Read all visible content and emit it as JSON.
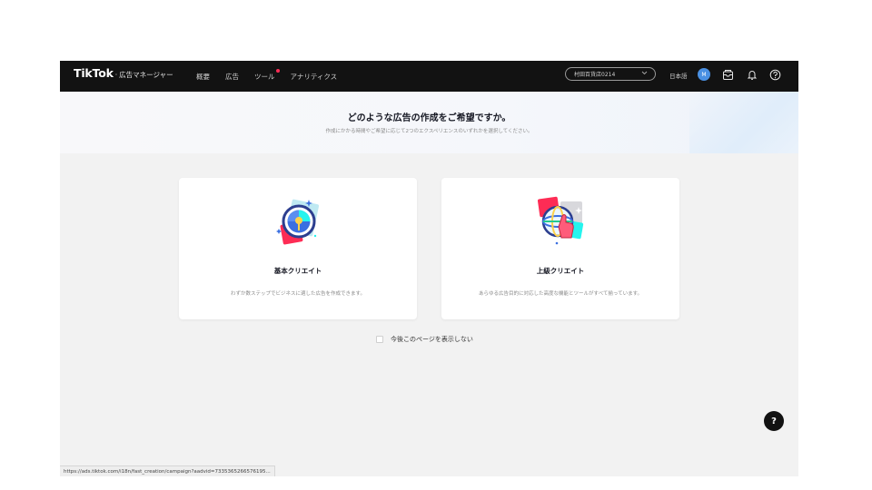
{
  "topbar": {
    "brand": "TikTok",
    "brand_suffix": "·",
    "product": "広告マネージャー",
    "nav": [
      "概要",
      "広告",
      "ツール",
      "アナリティクス"
    ],
    "account": "村田百貨店0214",
    "language": "日本語",
    "avatar_initial": "M"
  },
  "hero": {
    "title": "どのような広告の作成をご希望ですか。",
    "subtitle": "作成にかかる時間やご希望に応じて2つのエクスペリエンスのいずれかを選択してください。"
  },
  "cards": [
    {
      "title": "基本クリエイト",
      "description": "わずか数ステップでビジネスに適した広告を作成できます。",
      "icon": "target-illustration"
    },
    {
      "title": "上級クリエイト",
      "description": "あらゆる広告目的に対応した高度な機能とツールがすべて揃っています。",
      "icon": "globe-hand-illustration"
    }
  ],
  "dont_show_again": "今後このページを表示しない",
  "help_glyph": "?",
  "status_url": "https://ads.tiktok.com/i18n/fast_creation/campaign?aadvid=7335365266576195...",
  "colors": {
    "topbar_bg": "#121212",
    "page_bg": "#f2f2f2",
    "accent_red": "#fe2c55",
    "accent_cyan": "#25f4ee",
    "avatar_blue": "#4a90e2"
  }
}
